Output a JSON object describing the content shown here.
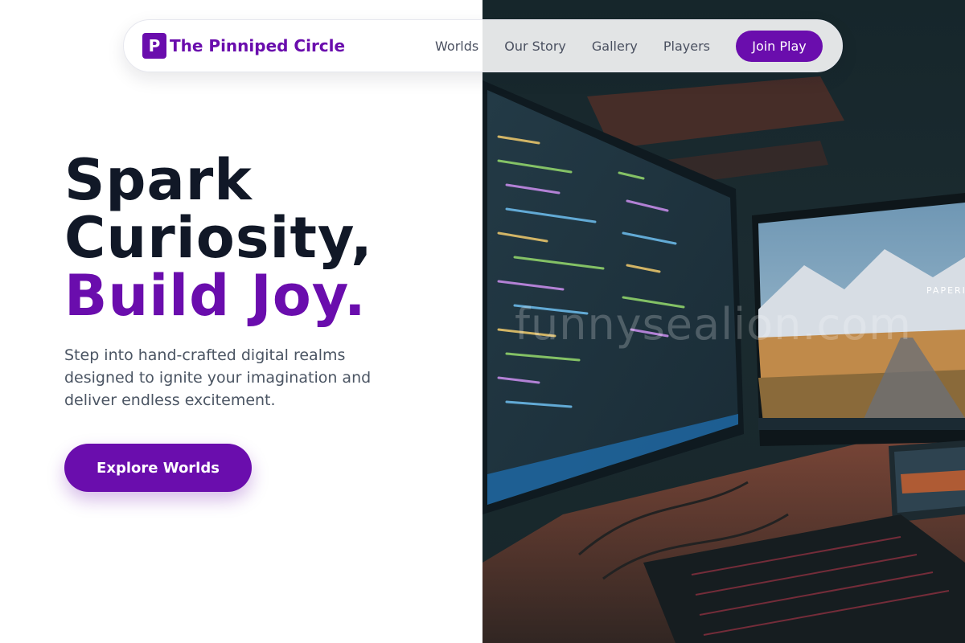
{
  "nav": {
    "logo_letter": "P",
    "brand_name": "The Pinniped Circle",
    "links": [
      "Worlds",
      "Our Story",
      "Gallery",
      "Players"
    ],
    "cta_label": "Join Play"
  },
  "hero": {
    "title_line1": "Spark",
    "title_line2": "Curiosity,",
    "title_accent": "Build Joy.",
    "subtitle": "Step into hand-crafted digital realms designed to ignite your imagination and deliver endless excitement.",
    "cta_label": "Explore Worlds"
  },
  "image": {
    "watermark": "funnysealion.com",
    "screen_text": "PAPERIZ"
  },
  "colors": {
    "accent": "#6a0dad",
    "heading": "#111827",
    "body_text": "#4b5563"
  }
}
